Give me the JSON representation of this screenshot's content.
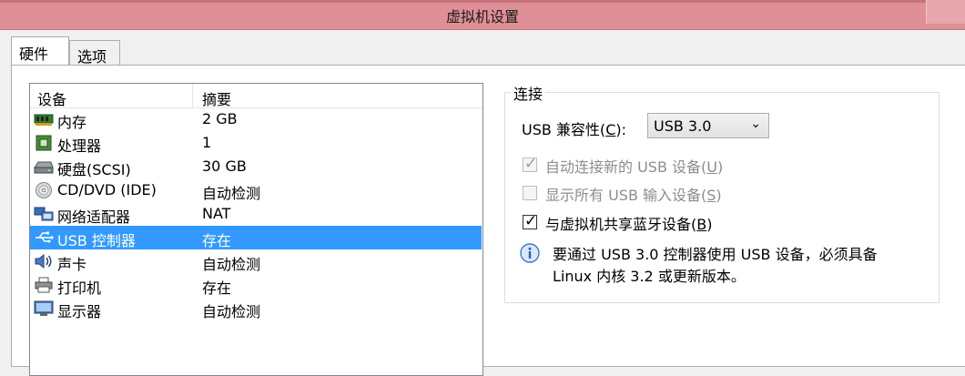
{
  "window": {
    "title": "虚拟机设置"
  },
  "tabs": [
    {
      "label": "硬件",
      "active": true
    },
    {
      "label": "选项",
      "active": false
    }
  ],
  "device_list": {
    "columns": [
      "设备",
      "摘要"
    ],
    "items": [
      {
        "name": "内存",
        "summary": "2 GB",
        "icon": "memory-icon"
      },
      {
        "name": "处理器",
        "summary": "1",
        "icon": "processor-icon"
      },
      {
        "name": "硬盘(SCSI)",
        "summary": "30 GB",
        "icon": "hard-disk-icon"
      },
      {
        "name": "CD/DVD (IDE)",
        "summary": "自动检测",
        "icon": "cd-dvd-icon"
      },
      {
        "name": "网络适配器",
        "summary": "NAT",
        "icon": "network-adapter-icon"
      },
      {
        "name": "USB 控制器",
        "summary": "存在",
        "icon": "usb-icon",
        "selected": true
      },
      {
        "name": "声卡",
        "summary": "自动检测",
        "icon": "sound-card-icon"
      },
      {
        "name": "打印机",
        "summary": "存在",
        "icon": "printer-icon"
      },
      {
        "name": "显示器",
        "summary": "自动检测",
        "icon": "display-icon"
      }
    ]
  },
  "connection": {
    "legend": "连接",
    "compat_label_pre": "USB 兼容性(",
    "compat_key": "C",
    "compat_label_post": "):",
    "compat_value": "USB 3.0",
    "auto_connect": {
      "pre": "自动连接新的 USB 设备(",
      "key": "U",
      "post": ")",
      "checked": true,
      "enabled": false
    },
    "show_all": {
      "pre": "显示所有 USB 输入设备(",
      "key": "S",
      "post": ")",
      "checked": false,
      "enabled": false
    },
    "share_bt": {
      "pre": "与虚拟机共享蓝牙设备(",
      "key": "B",
      "post": ")",
      "checked": true,
      "enabled": true
    },
    "note_line1": "要通过 USB 3.0 控制器使用 USB 设备，必须具备",
    "note_line2": "Linux 内核 3.2 或更新版本。"
  },
  "colors": {
    "titlebar": "#df8f96",
    "selection": "#3399ff"
  }
}
